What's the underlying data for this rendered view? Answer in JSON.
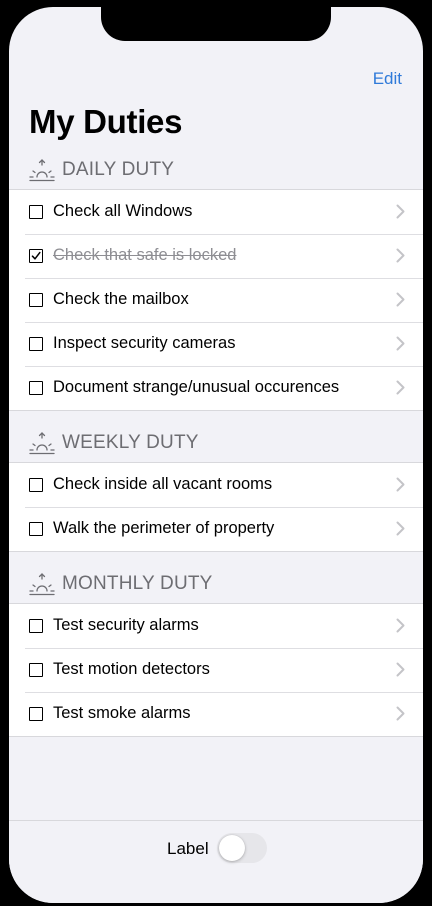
{
  "nav": {
    "edit_label": "Edit",
    "title": "My Duties"
  },
  "sections": [
    {
      "header": "DAILY DUTY",
      "icon": "sunrise-icon",
      "items": [
        {
          "label": "Check all Windows",
          "checked": false
        },
        {
          "label": "Check that safe is locked",
          "checked": true
        },
        {
          "label": "Check the mailbox",
          "checked": false
        },
        {
          "label": "Inspect security cameras",
          "checked": false
        },
        {
          "label": "Document strange/unusual occurences",
          "checked": false
        }
      ]
    },
    {
      "header": "WEEKLY DUTY",
      "icon": "sunrise-icon",
      "items": [
        {
          "label": "Check inside all vacant rooms",
          "checked": false
        },
        {
          "label": "Walk the perimeter of property",
          "checked": false
        }
      ]
    },
    {
      "header": "MONTHLY DUTY",
      "icon": "sunrise-icon",
      "items": [
        {
          "label": "Test security alarms",
          "checked": false
        },
        {
          "label": "Test motion detectors",
          "checked": false
        },
        {
          "label": "Test smoke alarms",
          "checked": false
        }
      ]
    }
  ],
  "bottom": {
    "toggle_label": "Label",
    "toggle_on": false
  },
  "colors": {
    "accent": "#2f7ad9",
    "background": "#f2f2f7",
    "header_text": "#6d6d72"
  }
}
